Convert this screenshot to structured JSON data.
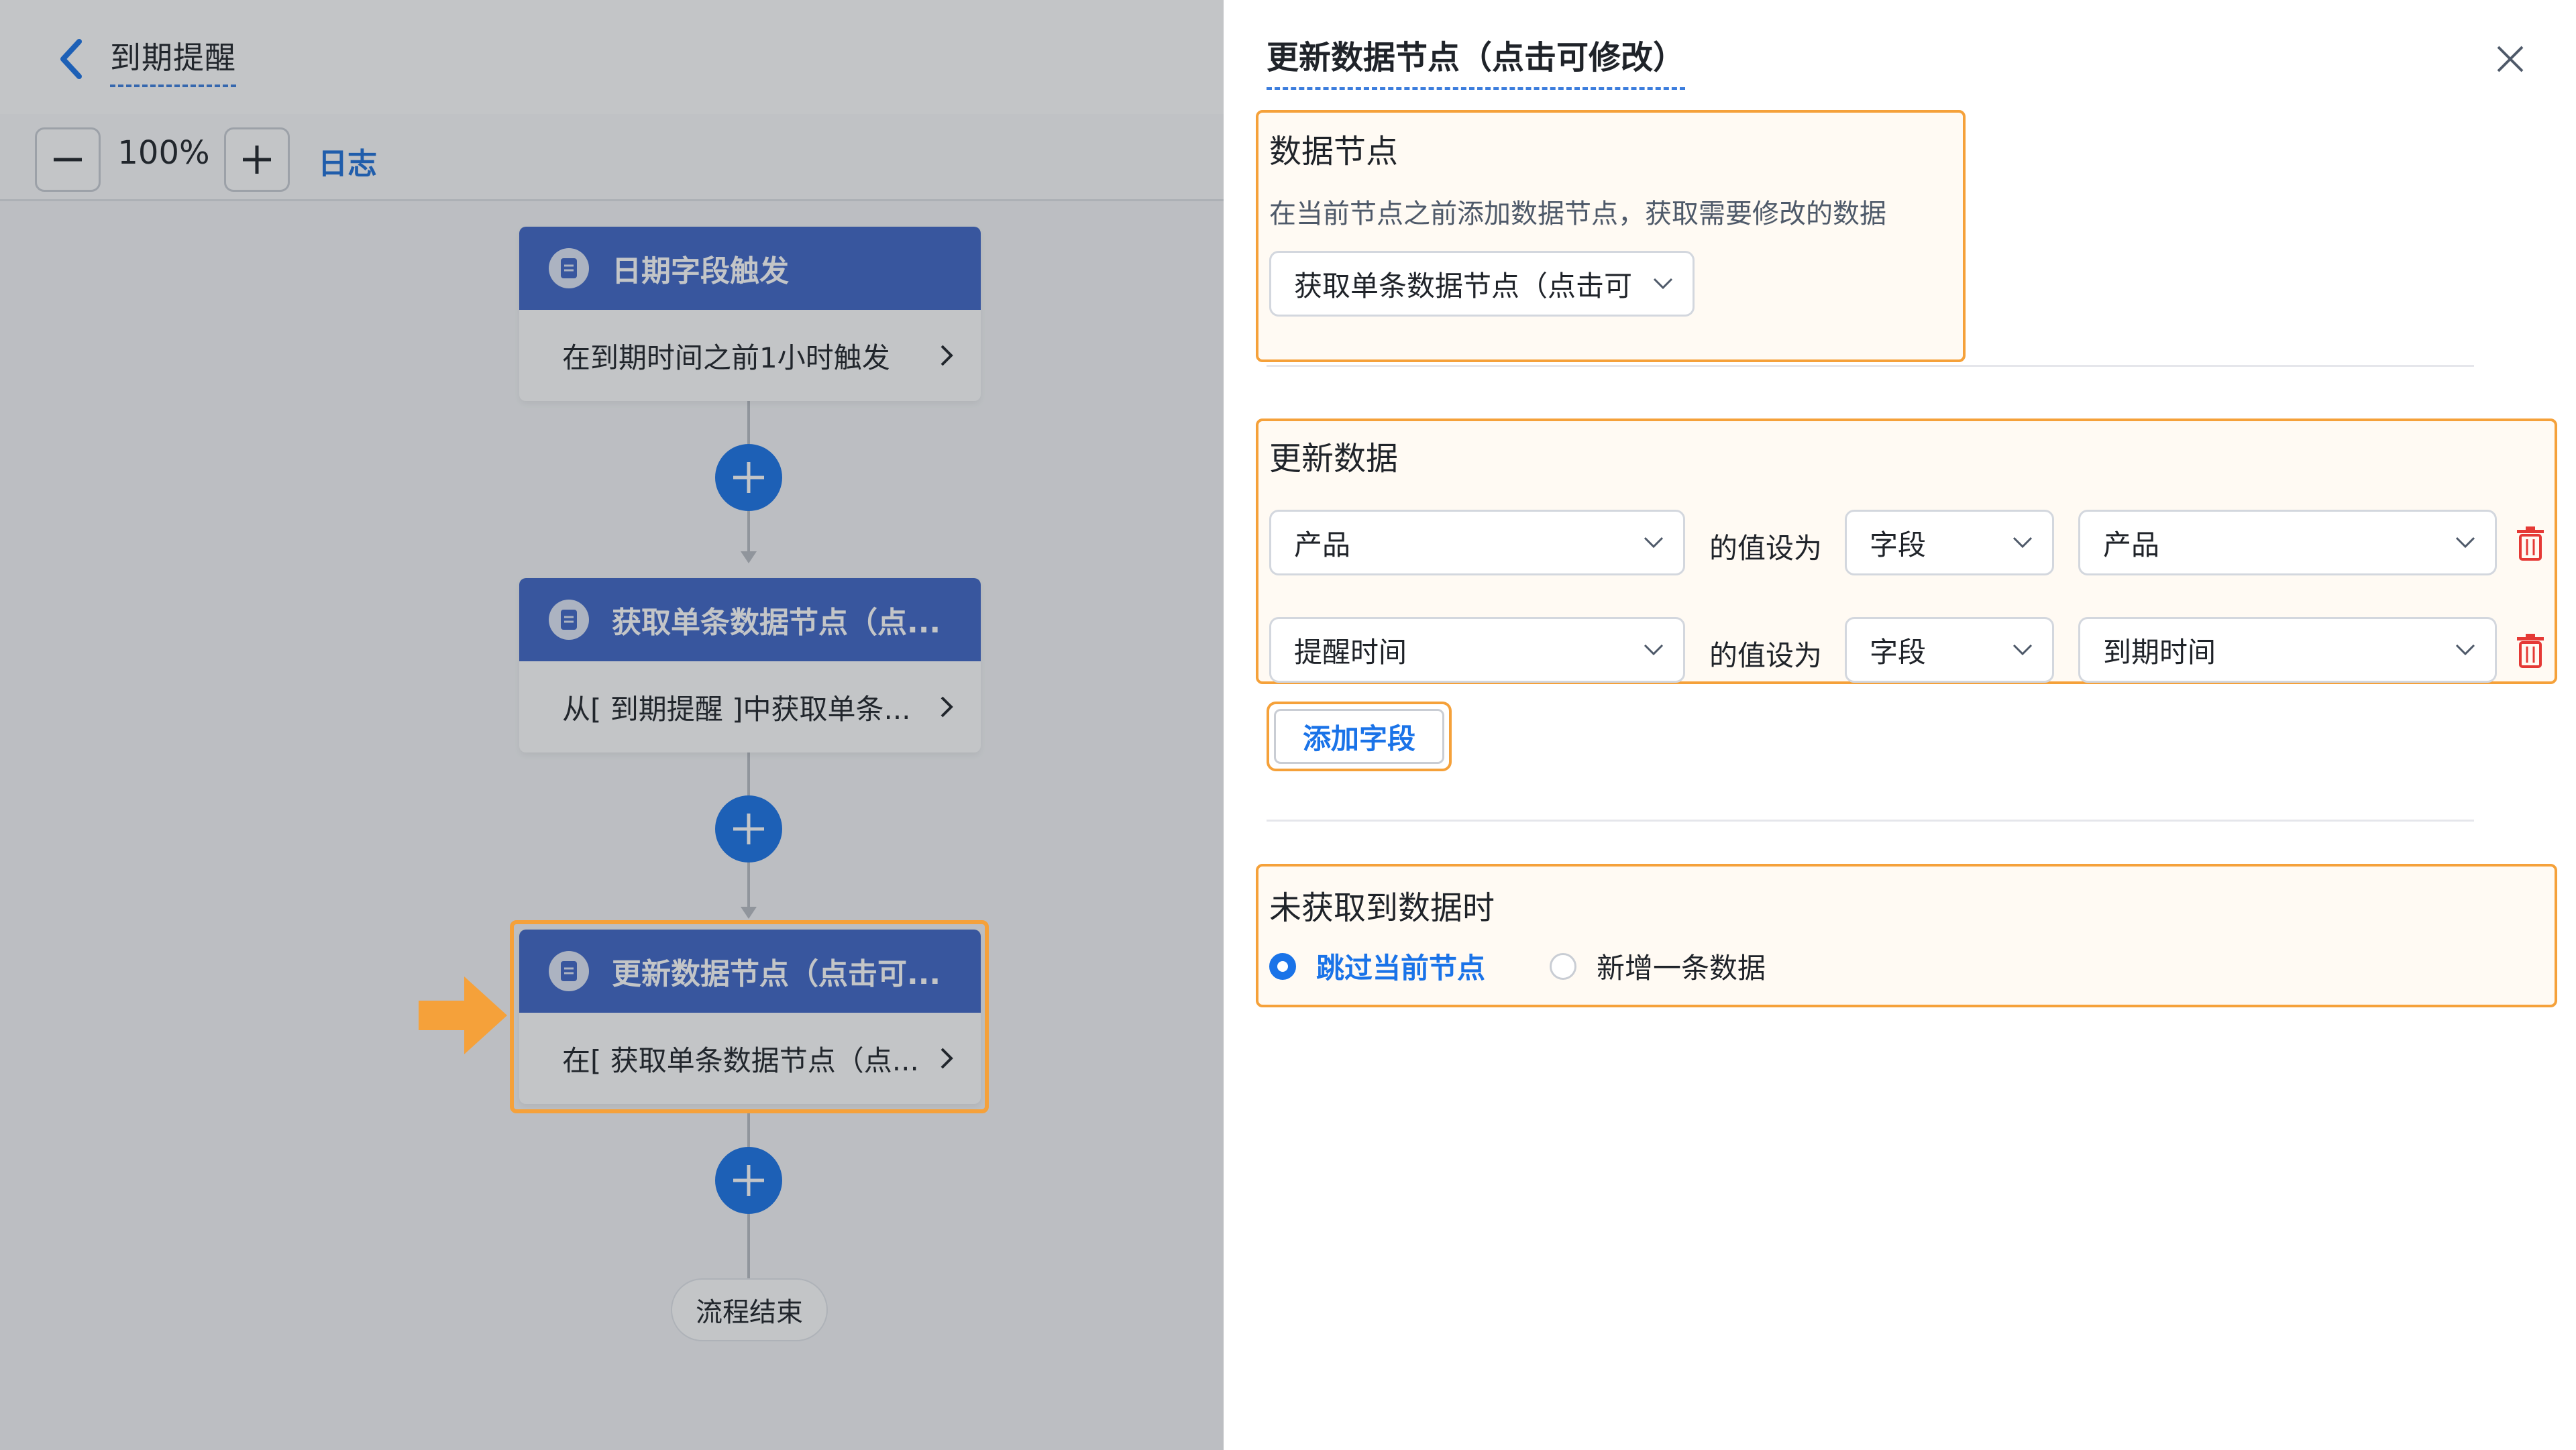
{
  "header": {
    "title": "到期提醒"
  },
  "toolbar": {
    "zoom": "100%",
    "log_label": "日志"
  },
  "flow": {
    "nodes": [
      {
        "title": "日期字段触发",
        "desc": "在到期时间之前1小时触发"
      },
      {
        "title": "获取单条数据节点（点...",
        "desc": "从[ 到期提醒 ]中获取单条..."
      },
      {
        "title": "更新数据节点（点击可...",
        "desc": "在[ 获取单条数据节点（点..."
      }
    ],
    "end_label": "流程结束"
  },
  "panel": {
    "title": "更新数据节点（点击可修改）",
    "data_node": {
      "title": "数据节点",
      "desc": "在当前节点之前添加数据节点，获取需要修改的数据",
      "selected": "获取单条数据节点（点击可"
    },
    "update": {
      "title": "更新数据",
      "set_label": "的值设为",
      "rows": [
        {
          "field": "产品",
          "type": "字段",
          "value": "产品"
        },
        {
          "field": "提醒时间",
          "type": "字段",
          "value": "到期时间"
        }
      ],
      "add_label": "添加字段"
    },
    "not_found": {
      "title": "未获取到数据时",
      "options": [
        {
          "label": "跳过当前节点",
          "selected": true
        },
        {
          "label": "新增一条数据",
          "selected": false
        }
      ]
    }
  },
  "colors": {
    "accent": "#1a73e8",
    "highlight": "#f5a13a",
    "node_header": "#3f66c6",
    "danger": "#e53935"
  }
}
